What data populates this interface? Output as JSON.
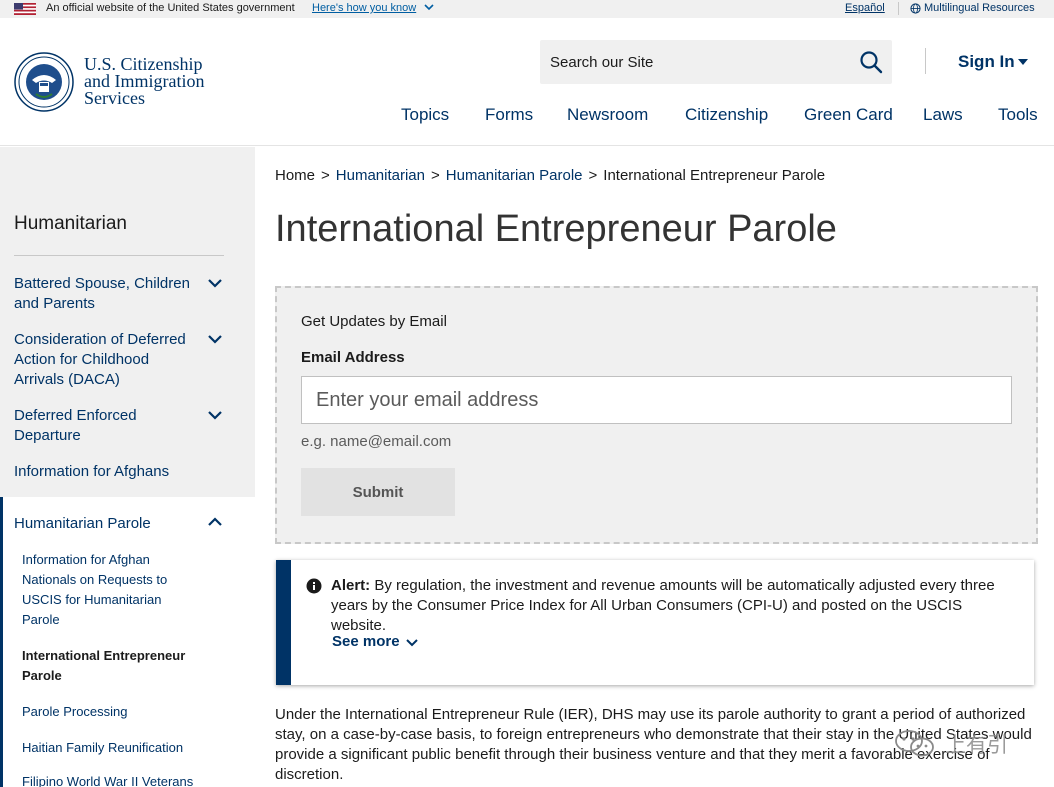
{
  "gov_banner": {
    "official_text": "An official website of the United States government",
    "how_you_know": "Here's how you know",
    "espanol": "Español",
    "multilingual": "Multilingual Resources"
  },
  "header": {
    "logo_lines": [
      "U.S. Citizenship",
      "and Immigration",
      "Services"
    ],
    "search_placeholder": "Search our Site",
    "sign_in": "Sign In",
    "nav": [
      "Topics",
      "Forms",
      "Newsroom",
      "Citizenship",
      "Green Card",
      "Laws",
      "Tools"
    ]
  },
  "sidebar": {
    "title": "Humanitarian",
    "items": [
      {
        "label": "Battered Spouse, Children and Parents",
        "expandable": true
      },
      {
        "label": "Consideration of Deferred Action for Childhood Arrivals (DACA)",
        "expandable": true
      },
      {
        "label": "Deferred Enforced Departure",
        "expandable": true
      },
      {
        "label": "Information for Afghans",
        "expandable": false
      },
      {
        "label": "Humanitarian Parole",
        "expandable": true,
        "expanded": true
      }
    ],
    "sub_items": [
      {
        "label": "Information for Afghan Nationals on Requests to USCIS for Humanitarian Parole",
        "active": false
      },
      {
        "label": "International Entrepreneur Parole",
        "active": true
      },
      {
        "label": "Parole Processing",
        "active": false
      },
      {
        "label": "Haitian Family Reunification",
        "active": false
      },
      {
        "label": "Filipino World War II Veterans",
        "active": false
      }
    ]
  },
  "breadcrumb": [
    "Home",
    "Humanitarian",
    "Humanitarian Parole",
    "International Entrepreneur Parole"
  ],
  "page_title": "International Entrepreneur Parole",
  "updates": {
    "heading": "Get Updates by Email",
    "email_label": "Email Address",
    "email_placeholder": "Enter your email address",
    "hint": "e.g. name@email.com",
    "submit": "Submit"
  },
  "alert": {
    "label": "Alert:",
    "text": " By regulation, the investment and revenue amounts will be automatically adjusted every three years by the Consumer Price Index for All Urban Consumers (CPI-U) and posted on the USCIS website.",
    "see_more": "See more"
  },
  "body_text": "Under the International Entrepreneur Rule (IER), DHS may use its parole authority to grant a period of authorized stay, on a case-by-case basis, to foreign entrepreneurs who demonstrate that their stay in the United States would provide a significant public benefit through their business venture and that they merit a favorable exercise of discretion.",
  "watermark_text": "上有引",
  "colors": {
    "brand_navy": "#003366",
    "link_blue": "#005ea2",
    "panel_gray": "#f0f0f0",
    "text_dark": "#1b1b1b"
  }
}
